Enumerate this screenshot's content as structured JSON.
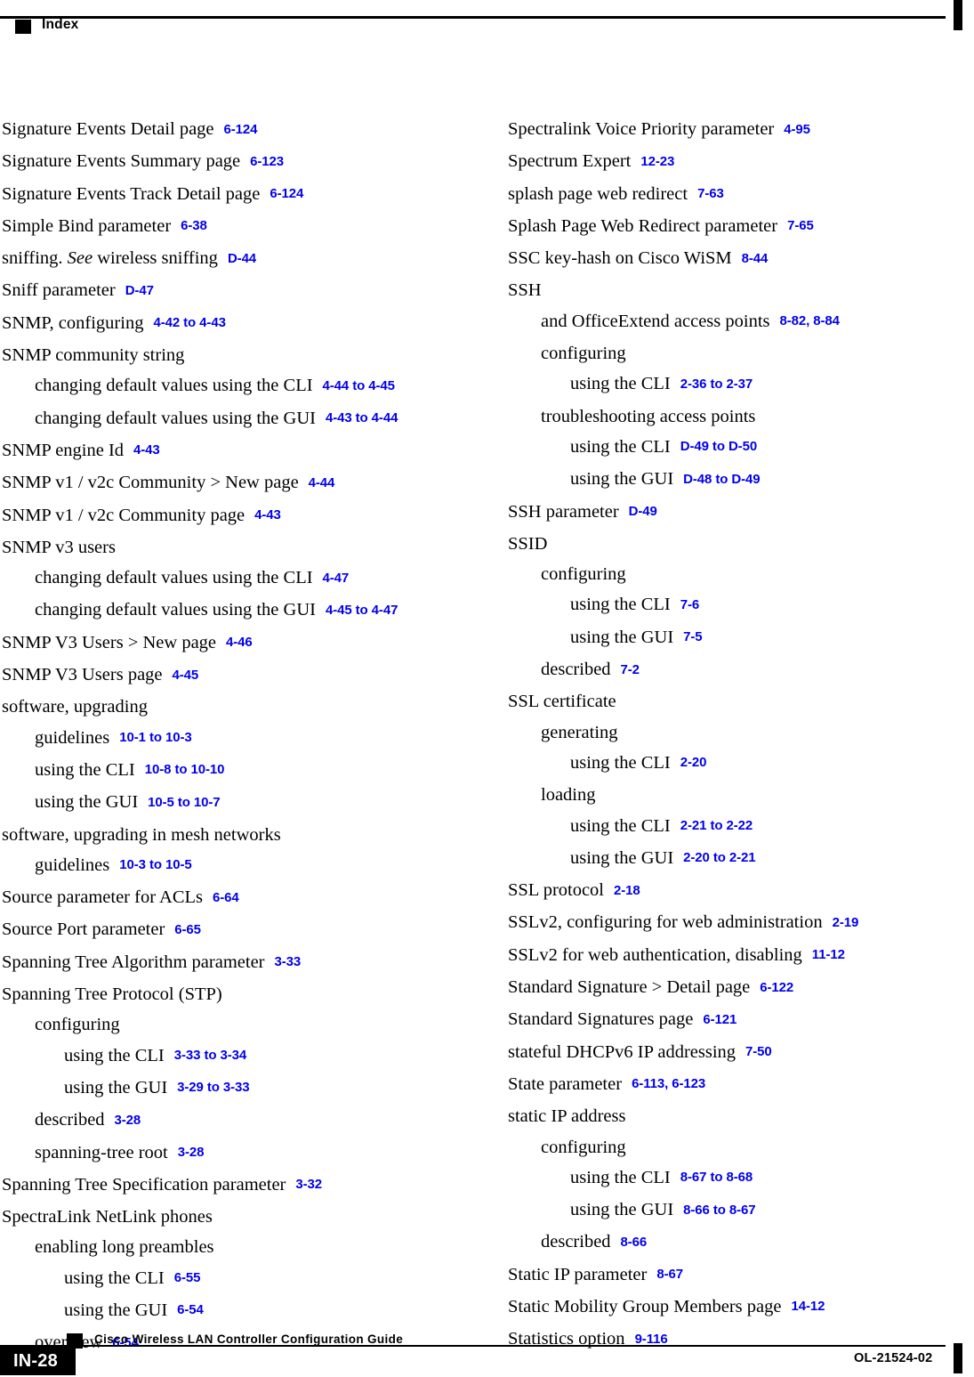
{
  "header": {
    "title": "Index"
  },
  "footer": {
    "page_number": "IN-28",
    "guide_title": "Cisco Wireless LAN Controller Configuration Guide",
    "doc_id": "OL-21524-02"
  },
  "colors": {
    "page_reference": "#0000ee",
    "text": "#000000",
    "rule": "#000000"
  },
  "index": {
    "left_column": [
      {
        "level": 0,
        "text": "Signature Events Detail page",
        "ref": "6-124"
      },
      {
        "level": 0,
        "text": "Signature Events Summary page",
        "ref": "6-123"
      },
      {
        "level": 0,
        "text": "Signature Events Track Detail page",
        "ref": "6-124"
      },
      {
        "level": 0,
        "text": "Simple Bind parameter",
        "ref": "6-38"
      },
      {
        "level": 0,
        "text": "sniffing. ",
        "italic": "See",
        "text_after": " wireless sniffing",
        "ref": "D-44"
      },
      {
        "level": 0,
        "text": "Sniff parameter",
        "ref": "D-47"
      },
      {
        "level": 0,
        "text": "SNMP, configuring",
        "ref": "4-42 to 4-43"
      },
      {
        "level": 0,
        "text": "SNMP community string",
        "ref": ""
      },
      {
        "level": 1,
        "text": "changing default values using the CLI",
        "ref": "4-44 to 4-45"
      },
      {
        "level": 1,
        "text": "changing default values using the GUI",
        "ref": "4-43 to 4-44"
      },
      {
        "level": 0,
        "text": "SNMP engine Id",
        "ref": "4-43"
      },
      {
        "level": 0,
        "text": "SNMP v1 / v2c Community > New page",
        "ref": "4-44"
      },
      {
        "level": 0,
        "text": "SNMP v1 / v2c Community page",
        "ref": "4-43"
      },
      {
        "level": 0,
        "text": "SNMP v3 users",
        "ref": ""
      },
      {
        "level": 1,
        "text": "changing default values using the CLI",
        "ref": "4-47"
      },
      {
        "level": 1,
        "text": "changing default values using the GUI",
        "ref": "4-45 to 4-47"
      },
      {
        "level": 0,
        "text": "SNMP V3 Users > New page",
        "ref": "4-46"
      },
      {
        "level": 0,
        "text": "SNMP V3 Users page",
        "ref": "4-45"
      },
      {
        "level": 0,
        "text": "software, upgrading",
        "ref": ""
      },
      {
        "level": 1,
        "text": "guidelines",
        "ref": "10-1 to 10-3"
      },
      {
        "level": 1,
        "text": "using the CLI",
        "ref": "10-8 to 10-10"
      },
      {
        "level": 1,
        "text": "using the GUI",
        "ref": "10-5 to 10-7"
      },
      {
        "level": 0,
        "text": "software, upgrading in mesh networks",
        "ref": ""
      },
      {
        "level": 1,
        "text": "guidelines",
        "ref": "10-3 to 10-5"
      },
      {
        "level": 0,
        "text": "Source parameter for ACLs",
        "ref": "6-64"
      },
      {
        "level": 0,
        "text": "Source Port parameter",
        "ref": "6-65"
      },
      {
        "level": 0,
        "text": "Spanning Tree Algorithm parameter",
        "ref": "3-33"
      },
      {
        "level": 0,
        "text": "Spanning Tree Protocol (STP)",
        "ref": ""
      },
      {
        "level": 1,
        "text": "configuring",
        "ref": ""
      },
      {
        "level": 2,
        "text": "using the CLI",
        "ref": "3-33 to 3-34"
      },
      {
        "level": 2,
        "text": "using the GUI",
        "ref": "3-29 to 3-33"
      },
      {
        "level": 1,
        "text": "described",
        "ref": "3-28"
      },
      {
        "level": 1,
        "text": "spanning-tree root",
        "ref": "3-28"
      },
      {
        "level": 0,
        "text": "Spanning Tree Specification parameter",
        "ref": "3-32"
      },
      {
        "level": 0,
        "text": "SpectraLink NetLink phones",
        "ref": ""
      },
      {
        "level": 1,
        "text": "enabling long preambles",
        "ref": ""
      },
      {
        "level": 2,
        "text": "using the CLI",
        "ref": "6-55"
      },
      {
        "level": 2,
        "text": "using the GUI",
        "ref": "6-54"
      },
      {
        "level": 1,
        "text": "overview",
        "ref": "6-54"
      }
    ],
    "right_column": [
      {
        "level": 0,
        "text": "Spectralink Voice Priority parameter",
        "ref": "4-95"
      },
      {
        "level": 0,
        "text": "Spectrum Expert",
        "ref": "12-23"
      },
      {
        "level": 0,
        "text": "splash page web redirect",
        "ref": "7-63"
      },
      {
        "level": 0,
        "text": "Splash Page Web Redirect parameter",
        "ref": "7-65"
      },
      {
        "level": 0,
        "text": "SSC key-hash on Cisco WiSM",
        "ref": "8-44"
      },
      {
        "level": 0,
        "text": "SSH",
        "ref": ""
      },
      {
        "level": 1,
        "text": "and OfficeExtend access points",
        "ref": "8-82, 8-84"
      },
      {
        "level": 1,
        "text": "configuring",
        "ref": ""
      },
      {
        "level": 2,
        "text": "using the CLI",
        "ref": "2-36 to 2-37"
      },
      {
        "level": 1,
        "text": "troubleshooting access points",
        "ref": ""
      },
      {
        "level": 2,
        "text": "using the CLI",
        "ref": "D-49 to D-50"
      },
      {
        "level": 2,
        "text": "using the GUI",
        "ref": "D-48 to D-49"
      },
      {
        "level": 0,
        "text": "SSH parameter",
        "ref": "D-49"
      },
      {
        "level": 0,
        "text": "SSID",
        "ref": ""
      },
      {
        "level": 1,
        "text": "configuring",
        "ref": ""
      },
      {
        "level": 2,
        "text": "using the CLI",
        "ref": "7-6"
      },
      {
        "level": 2,
        "text": "using the GUI",
        "ref": "7-5"
      },
      {
        "level": 1,
        "text": "described",
        "ref": "7-2"
      },
      {
        "level": 0,
        "text": "SSL certificate",
        "ref": ""
      },
      {
        "level": 1,
        "text": "generating",
        "ref": ""
      },
      {
        "level": 2,
        "text": "using the CLI",
        "ref": "2-20"
      },
      {
        "level": 1,
        "text": "loading",
        "ref": ""
      },
      {
        "level": 2,
        "text": "using the CLI",
        "ref": "2-21 to 2-22"
      },
      {
        "level": 2,
        "text": "using the GUI",
        "ref": "2-20 to 2-21"
      },
      {
        "level": 0,
        "text": "SSL protocol",
        "ref": "2-18"
      },
      {
        "level": 0,
        "text": "SSLv2, configuring for web administration",
        "ref": "2-19"
      },
      {
        "level": 0,
        "text": "SSLv2 for web authentication, disabling",
        "ref": "11-12"
      },
      {
        "level": 0,
        "text": "Standard Signature > Detail page",
        "ref": "6-122"
      },
      {
        "level": 0,
        "text": "Standard Signatures page",
        "ref": "6-121"
      },
      {
        "level": 0,
        "text": "stateful DHCPv6 IP addressing",
        "ref": "7-50"
      },
      {
        "level": 0,
        "text": "State parameter",
        "ref": "6-113, 6-123"
      },
      {
        "level": 0,
        "text": "static IP address",
        "ref": ""
      },
      {
        "level": 1,
        "text": "configuring",
        "ref": ""
      },
      {
        "level": 2,
        "text": "using the CLI",
        "ref": "8-67 to 8-68"
      },
      {
        "level": 2,
        "text": "using the GUI",
        "ref": "8-66 to 8-67"
      },
      {
        "level": 1,
        "text": "described",
        "ref": "8-66"
      },
      {
        "level": 0,
        "text": "Static IP parameter",
        "ref": "8-67"
      },
      {
        "level": 0,
        "text": "Static Mobility Group Members page",
        "ref": "14-12"
      },
      {
        "level": 0,
        "text": "Statistics option",
        "ref": "9-116"
      }
    ]
  }
}
